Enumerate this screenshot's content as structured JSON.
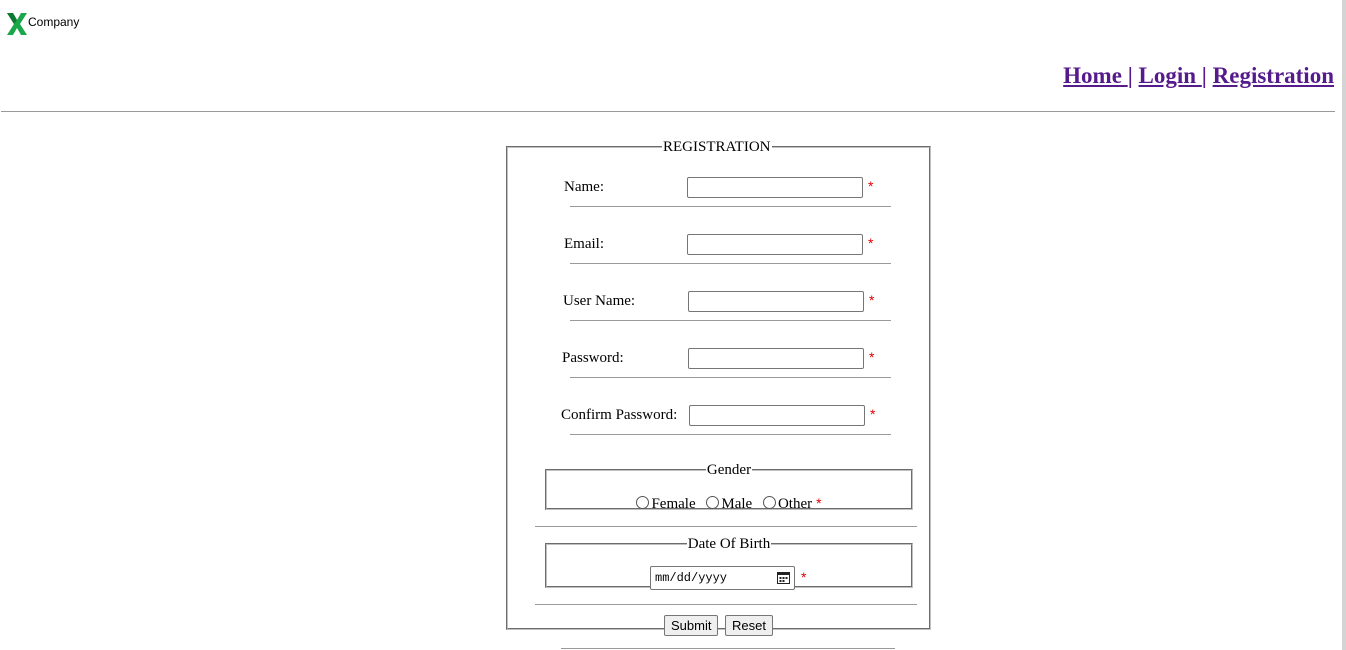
{
  "logo": {
    "text": "Company",
    "icon": "x-logo-icon",
    "accent": "#1aa64b"
  },
  "nav": {
    "home": "Home ",
    "login": "Login ",
    "registration": "Registration",
    "separator": "|",
    "link_color": "#551a8b"
  },
  "form": {
    "legend": "REGISTRATION",
    "required_mark": "*",
    "required_color": "#e00000",
    "fields": {
      "name": {
        "label": "Name:",
        "value": ""
      },
      "email": {
        "label": "Email:",
        "value": ""
      },
      "username": {
        "label": "User Name:",
        "value": ""
      },
      "password": {
        "label": "Password:",
        "value": ""
      },
      "confirm_password": {
        "label": "Confirm Password:",
        "value": ""
      }
    },
    "gender": {
      "legend": "Gender",
      "options": [
        "Female",
        "Male",
        "Other"
      ]
    },
    "dob": {
      "legend": "Date Of Birth",
      "placeholder": "mm/dd/yyyy"
    },
    "buttons": {
      "submit": "Submit",
      "reset": "Reset"
    }
  }
}
